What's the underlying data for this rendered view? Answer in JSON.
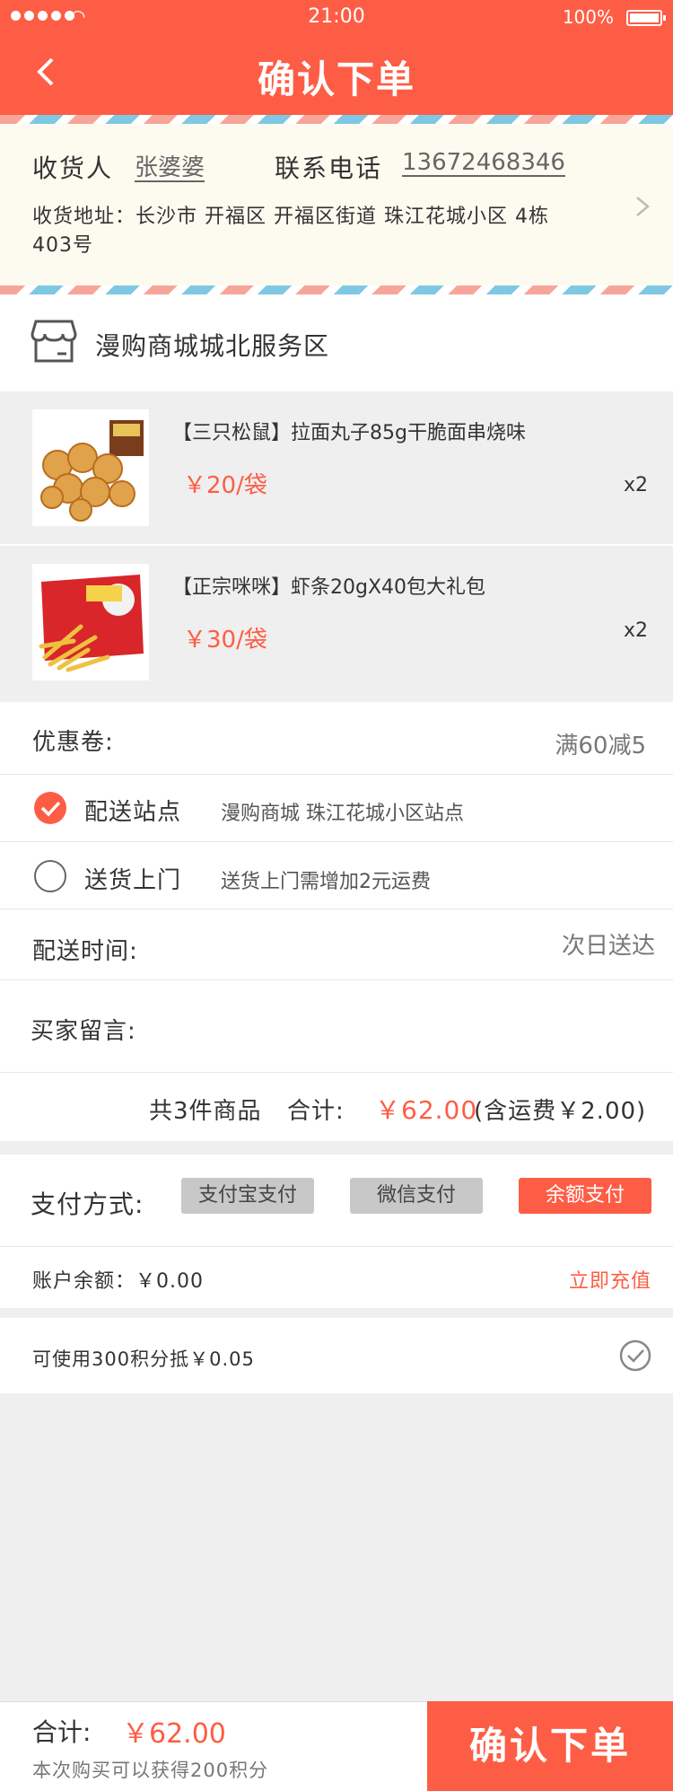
{
  "status_bar": {
    "time": "21:00",
    "battery": "100%"
  },
  "header": {
    "title": "确认下单"
  },
  "address": {
    "receiver_label": "收货人",
    "receiver_name": "张婆婆",
    "phone_label": "联系电话",
    "phone": "13672468346",
    "address_text": "收货地址：长沙市 开福区 开福区街道 珠江花城小区 4栋403号"
  },
  "shop": {
    "name": "漫购商城城北服务区"
  },
  "items": [
    {
      "name": "【三只松鼠】拉面丸子85g干脆面串烧味",
      "price": "￥20/袋",
      "qty": "x2",
      "image_icon": "noodle-snack-icon"
    },
    {
      "name": "【正宗咪咪】虾条20gX40包大礼包",
      "price": "￥30/袋",
      "qty": "x2",
      "image_icon": "shrimp-chips-icon"
    }
  ],
  "coupon": {
    "label": "优惠卷:",
    "value": "满60减5"
  },
  "delivery_options": [
    {
      "label": "配送站点",
      "desc": "漫购商城 珠江花城小区站点",
      "selected": true
    },
    {
      "label": "送货上门",
      "desc": "送货上门需增加2元运费",
      "selected": false
    }
  ],
  "delivery_time": {
    "label": "配送时间:",
    "value": "次日送达"
  },
  "message": {
    "label": "买家留言:"
  },
  "summary": {
    "count_text": "共3件商品",
    "total_label": "合计:",
    "total_value": "￥62.00",
    "shipping_note": "(含运费￥2.00)"
  },
  "payment": {
    "label": "支付方式:",
    "methods": [
      {
        "label": "支付宝支付",
        "active": false
      },
      {
        "label": "微信支付",
        "active": false
      },
      {
        "label": "余额支付",
        "active": true
      }
    ]
  },
  "balance": {
    "label": "账户余额：￥0.00",
    "recharge": "立即充值"
  },
  "points": {
    "text": "可使用300积分抵￥0.05"
  },
  "footer": {
    "total_label": "合计:",
    "total_value": "￥62.00",
    "points_note": "本次购买可以获得200积分",
    "confirm": "确认下单"
  },
  "colors": {
    "accent": "#fe5d45",
    "address_bg": "#fdfbf0",
    "page_bg": "#efefef"
  }
}
